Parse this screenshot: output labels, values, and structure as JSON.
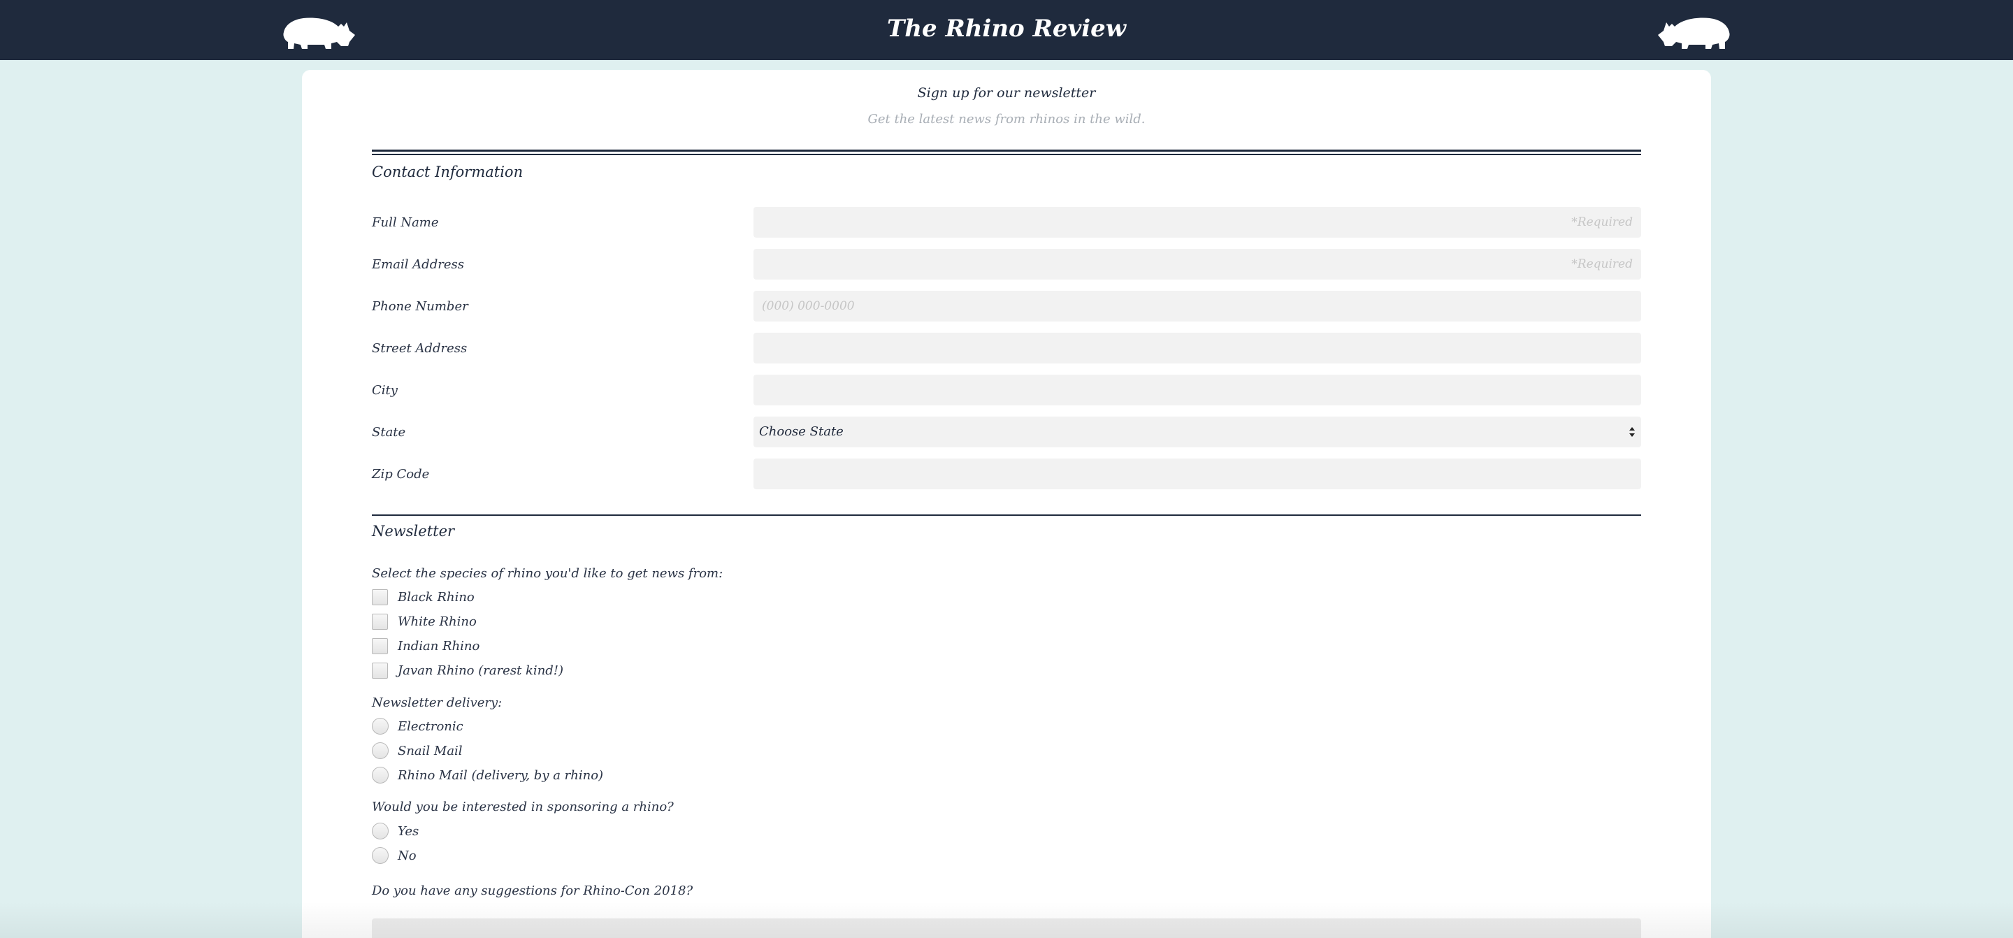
{
  "header": {
    "title": "The Rhino Review",
    "logo_left_icon": "rhino-icon",
    "logo_right_icon": "rhino-icon"
  },
  "form": {
    "title": "Sign up for our newsletter",
    "subtitle": "Get the latest news from rhinos in the wild."
  },
  "contact": {
    "heading": "Contact Information",
    "full_name_label": "Full Name",
    "full_name_placeholder": "*Required",
    "email_label": "Email Address",
    "email_placeholder": "*Required",
    "phone_label": "Phone Number",
    "phone_placeholder": "(000) 000-0000",
    "street_label": "Street Address",
    "city_label": "City",
    "state_label": "State",
    "state_selected": "Choose State",
    "zip_label": "Zip Code"
  },
  "newsletter": {
    "heading": "Newsletter",
    "species_question": "Select the species of rhino you'd like to get news from:",
    "species": [
      "Black Rhino",
      "White Rhino",
      "Indian Rhino",
      "Javan Rhino (rarest kind!)"
    ],
    "delivery_question": "Newsletter delivery:",
    "delivery": [
      "Electronic",
      "Snail Mail",
      "Rhino Mail (delivery, by a rhino)"
    ],
    "sponsor_question": "Would you be interested in sponsoring a rhino?",
    "sponsor": [
      "Yes",
      "No"
    ],
    "suggestions_question": "Do you have any suggestions for Rhino-Con 2018?"
  },
  "colors": {
    "header_bg": "#1f2a3d",
    "page_bg": "#dff0f0",
    "field_bg": "#f2f2f2"
  }
}
